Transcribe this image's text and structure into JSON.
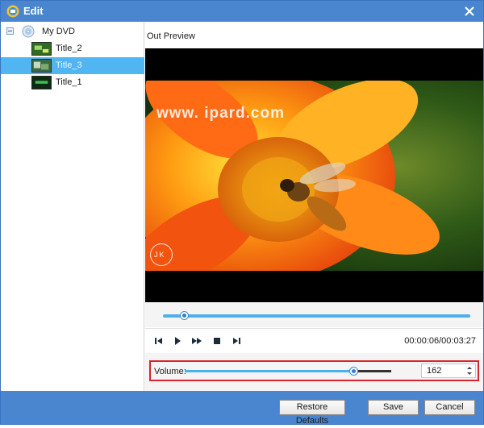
{
  "window": {
    "title": "Edit",
    "close_icon": "close-icon"
  },
  "tree": {
    "root_label": "My DVD",
    "items": [
      {
        "label": "Title_2",
        "selected": false
      },
      {
        "label": "Title_3",
        "selected": true
      },
      {
        "label": "Title_1",
        "selected": false
      }
    ]
  },
  "preview": {
    "label": "Out Preview",
    "watermark": "www.  ipard.com",
    "logo_letters": "JK"
  },
  "playback": {
    "progress_fraction": 0.07,
    "time": "00:00:06/00:03:27",
    "controls": [
      "skip-previous-icon",
      "play-icon",
      "fast-forward-icon",
      "stop-icon",
      "skip-next-icon"
    ]
  },
  "volume": {
    "label": "Volume:",
    "value": "162",
    "level_fraction": 0.82
  },
  "footer": {
    "restore_label": "Restore Defaults",
    "save_label": "Save",
    "cancel_label": "Cancel"
  },
  "colors": {
    "titlebar": "#4a86d0",
    "selection": "#51b5f2",
    "slider": "#4db0ec",
    "highlight_box": "#d6252f"
  }
}
